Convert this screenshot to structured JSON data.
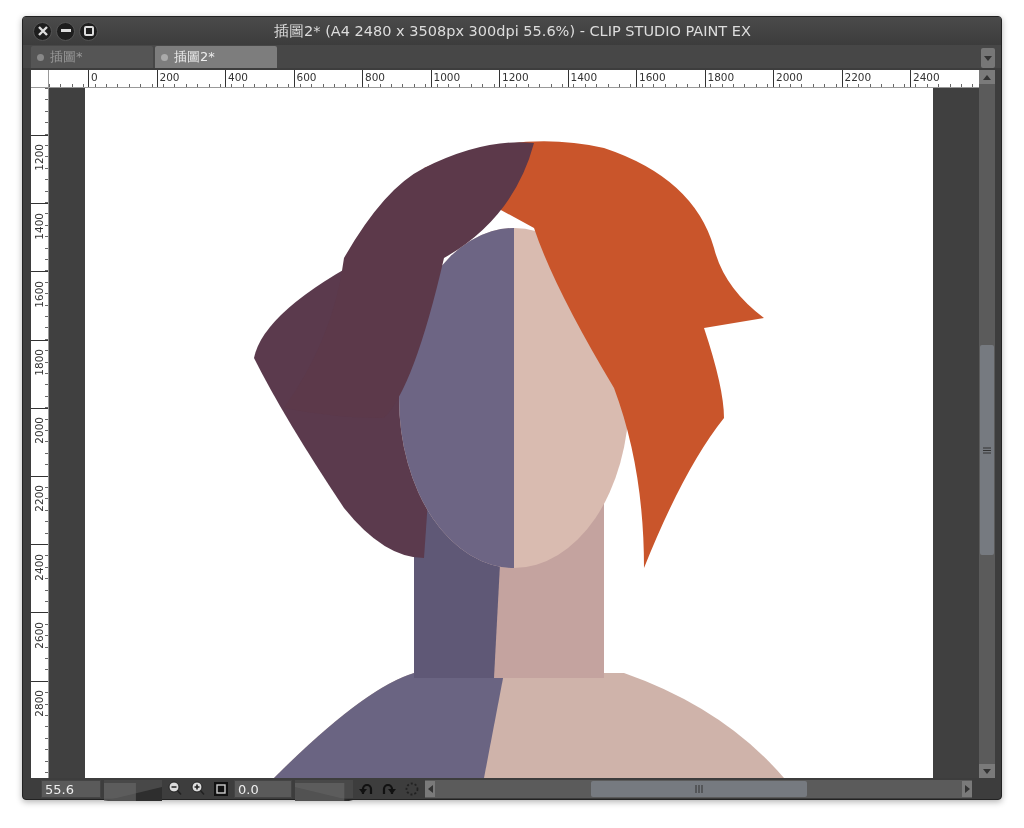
{
  "window": {
    "title": "插圖2* (A4 2480 x 3508px 300dpi 55.6%) - CLIP STUDIO PAINT EX"
  },
  "tabs": [
    {
      "label": "插圖*",
      "selected": false
    },
    {
      "label": "插圖2*",
      "selected": true
    }
  ],
  "ruler_horizontal": [
    "0",
    "200",
    "400",
    "600",
    "800",
    "1000",
    "1200",
    "1400",
    "1600",
    "1800",
    "2000",
    "2200",
    "2400"
  ],
  "ruler_vertical": [
    "1200",
    "1400",
    "1600",
    "1800",
    "2000",
    "2200",
    "2400",
    "2600",
    "2800"
  ],
  "status_bar": {
    "zoom": "55.6",
    "zoom_slider": {
      "level": 0.55
    },
    "angle": "0.0",
    "angle_slider": {
      "level": 0.85
    }
  }
}
